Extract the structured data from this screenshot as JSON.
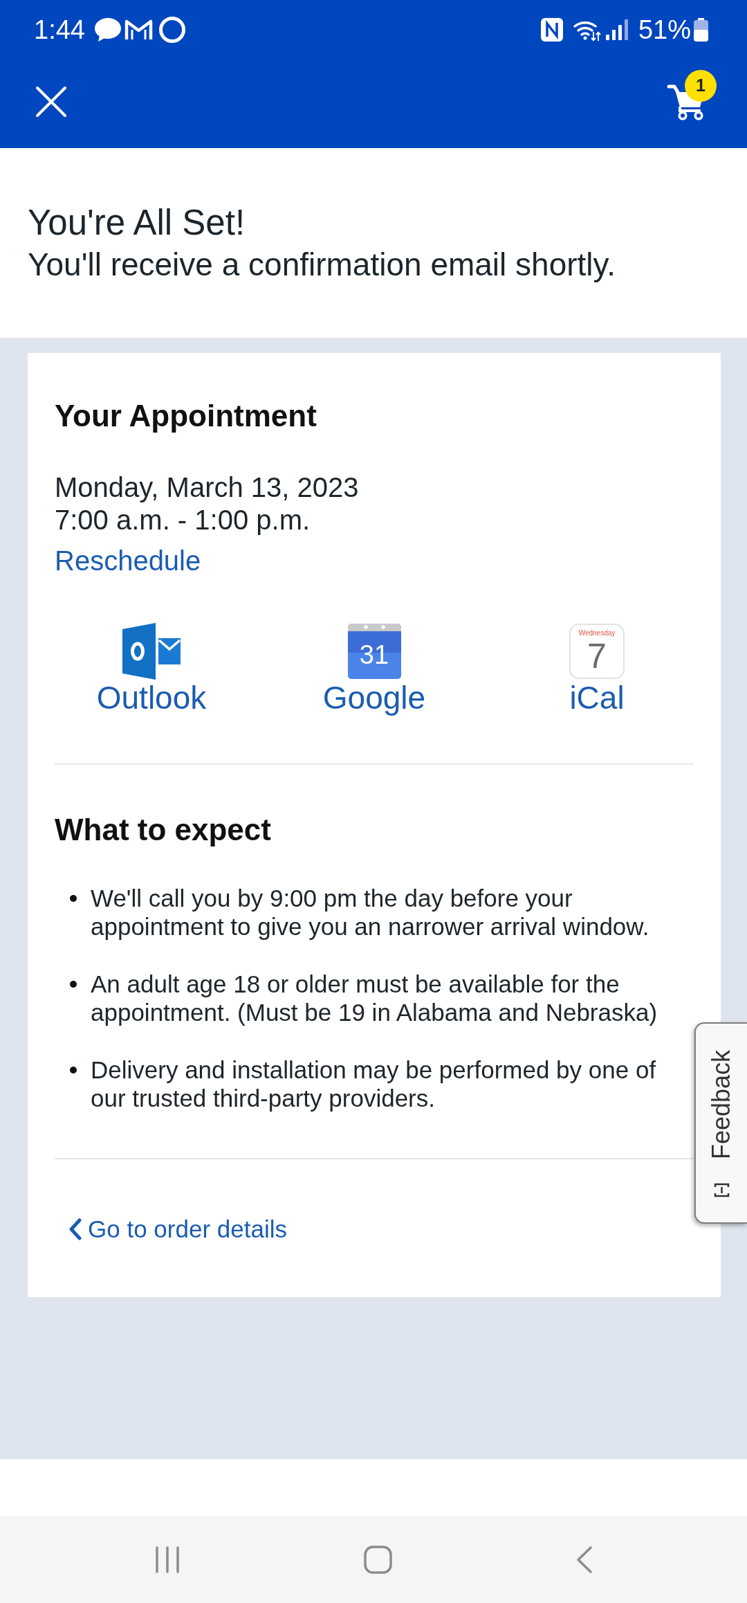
{
  "status_bar": {
    "time": "1:44",
    "battery": "51%"
  },
  "app_bar": {
    "cart_count": "1"
  },
  "header": {
    "title": "You're All Set!",
    "subtitle": "You'll receive a confirmation email shortly."
  },
  "appointment": {
    "heading": "Your Appointment",
    "date": "Monday, March 13, 2023",
    "time": "7:00 a.m. - 1:00 p.m.",
    "reschedule": "Reschedule",
    "calendars": [
      {
        "kind": "outlook",
        "label": "Outlook"
      },
      {
        "kind": "google",
        "label": "Google",
        "icon_text": [
          "31"
        ]
      },
      {
        "kind": "ical",
        "label": "iCal",
        "icon_text": [
          "Wednesday",
          "7"
        ]
      }
    ]
  },
  "what_to_expect": {
    "heading": "What to expect",
    "items": [
      "We'll call you by 9:00 pm the day before your appointment to give you an narrower arrival window.",
      "An adult age 18 or older must be available for the appointment. (Must be 19 in Alabama and Nebraska)",
      "Delivery and installation may be performed by one of our trusted third-party providers."
    ]
  },
  "order_link": "Go to order details",
  "feedback_tab": {
    "label": "Feedback"
  }
}
